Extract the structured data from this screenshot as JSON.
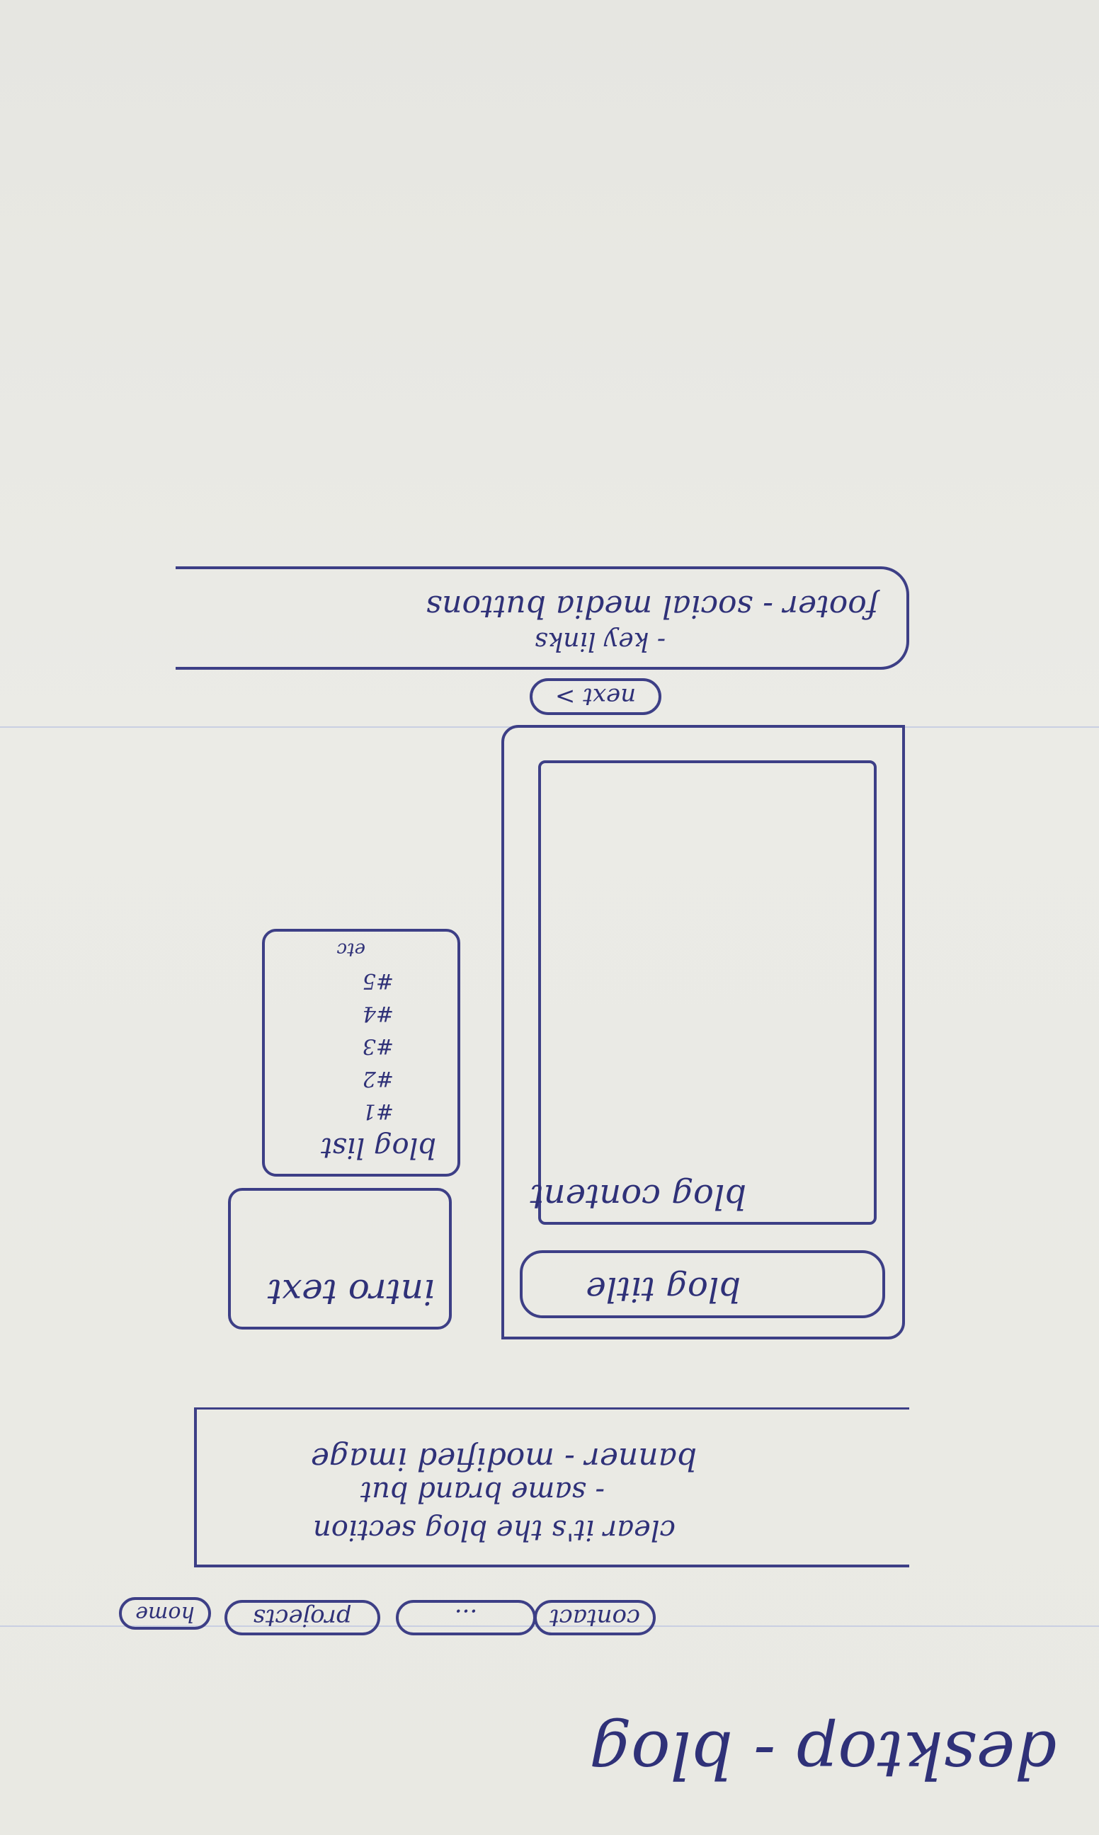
{
  "heading": "desktop - blog",
  "nav": {
    "items": [
      {
        "label": "home"
      },
      {
        "label": "projects"
      },
      {
        "label": "..."
      },
      {
        "label": "contact"
      }
    ]
  },
  "banner": {
    "line1": "banner - modified image",
    "line2": "- same brand but",
    "line3": "clear it's the blog section"
  },
  "intro": {
    "label": "intro text"
  },
  "blog_list": {
    "title": "blog list",
    "items": [
      "#1",
      "#2",
      "#3",
      "#4",
      "#5"
    ],
    "etc": "etc"
  },
  "blog_title": {
    "label": "blog title"
  },
  "blog_content": {
    "label": "blog content"
  },
  "next_button": {
    "label": "next >"
  },
  "footer": {
    "line1": "footer - social media buttons",
    "line2": "- key links"
  },
  "colors": {
    "ink": "#3d3f86",
    "paper": "#e9e9e4",
    "rule": "#c9cfe2"
  }
}
